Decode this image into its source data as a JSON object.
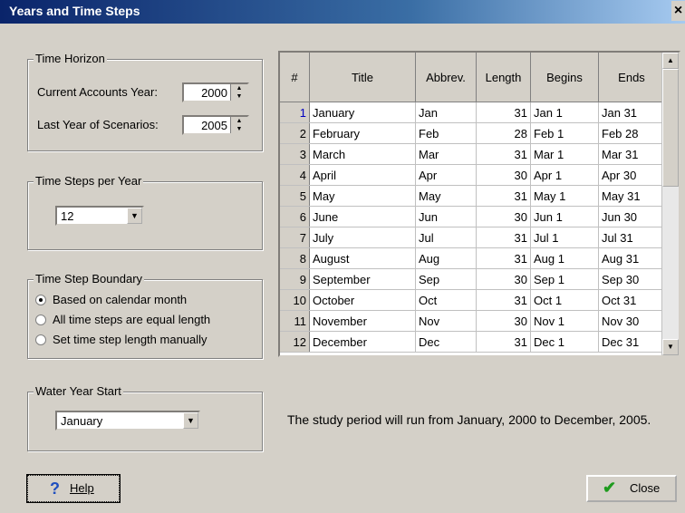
{
  "window": {
    "title": "Years and Time Steps",
    "close_glyph": "×"
  },
  "time_horizon": {
    "group_label": "Time Horizon",
    "current_accounts_label": "Current Accounts Year:",
    "current_accounts_value": "2000",
    "last_year_label": "Last Year of Scenarios:",
    "last_year_value": "2005"
  },
  "time_steps": {
    "group_label": "Time Steps per Year",
    "value": "12"
  },
  "boundary": {
    "group_label": "Time Step Boundary",
    "options": [
      "Based on calendar month",
      "All time steps are equal length",
      "Set time step length manually"
    ],
    "selected_index": 0
  },
  "water_year": {
    "group_label": "Water Year Start",
    "value": "January"
  },
  "table": {
    "headers": [
      "#",
      "Title",
      "Abbrev.",
      "Length",
      "Begins",
      "Ends"
    ],
    "rows": [
      [
        "1",
        "January",
        "Jan",
        "31",
        "Jan 1",
        "Jan 31"
      ],
      [
        "2",
        "February",
        "Feb",
        "28",
        "Feb 1",
        "Feb 28"
      ],
      [
        "3",
        "March",
        "Mar",
        "31",
        "Mar 1",
        "Mar 31"
      ],
      [
        "4",
        "April",
        "Apr",
        "30",
        "Apr 1",
        "Apr 30"
      ],
      [
        "5",
        "May",
        "May",
        "31",
        "May 1",
        "May 31"
      ],
      [
        "6",
        "June",
        "Jun",
        "30",
        "Jun 1",
        "Jun 30"
      ],
      [
        "7",
        "July",
        "Jul",
        "31",
        "Jul 1",
        "Jul 31"
      ],
      [
        "8",
        "August",
        "Aug",
        "31",
        "Aug 1",
        "Aug 31"
      ],
      [
        "9",
        "September",
        "Sep",
        "30",
        "Sep 1",
        "Sep 30"
      ],
      [
        "10",
        "October",
        "Oct",
        "31",
        "Oct 1",
        "Oct 31"
      ],
      [
        "11",
        "November",
        "Nov",
        "30",
        "Nov 1",
        "Nov 30"
      ],
      [
        "12",
        "December",
        "Dec",
        "31",
        "Dec 1",
        "Dec 31"
      ]
    ]
  },
  "message": "The study period will run from January, 2000 to December, 2005.",
  "buttons": {
    "help": "Help",
    "close": "Close"
  },
  "icons": {
    "help": "question-mark-icon",
    "close": "checkmark-icon"
  },
  "colors": {
    "title_bar": "#0a246a",
    "help_icon": "#1f4fbf",
    "check_icon": "#1e9b1e"
  }
}
